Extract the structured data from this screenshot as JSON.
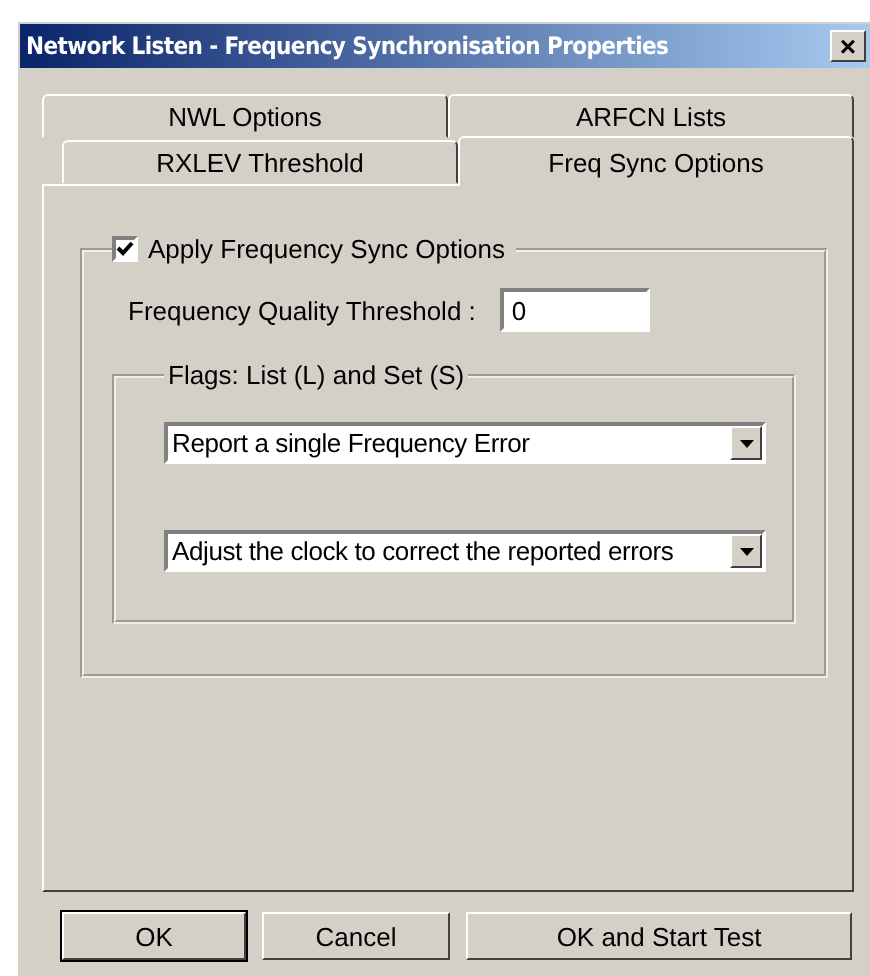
{
  "window": {
    "title": "Network Listen - Frequency Synchronisation Properties",
    "close": "×"
  },
  "tab_rows": [
    [
      {
        "label": "NWL Options",
        "selected": false
      },
      {
        "label": "ARFCN Lists",
        "selected": false
      }
    ],
    [
      {
        "label": "RXLEV Threshold",
        "selected": false
      },
      {
        "label": "Freq Sync Options",
        "selected": true
      }
    ]
  ],
  "options_group": {
    "label": "Apply Frequency Sync Options",
    "checked": true,
    "threshold": {
      "label": "Frequency Quality Threshold :",
      "value": "0"
    },
    "flags": {
      "label": "Flags: List (L) and Set (S)",
      "dropdowns": [
        {
          "value": "Report a single Frequency Error"
        },
        {
          "value": "Adjust the clock to correct the reported errors"
        }
      ]
    }
  },
  "buttons": [
    {
      "label": "OK",
      "default": true
    },
    {
      "label": "Cancel",
      "default": false
    },
    {
      "label": "OK  and  Start Test",
      "default": false
    }
  ]
}
